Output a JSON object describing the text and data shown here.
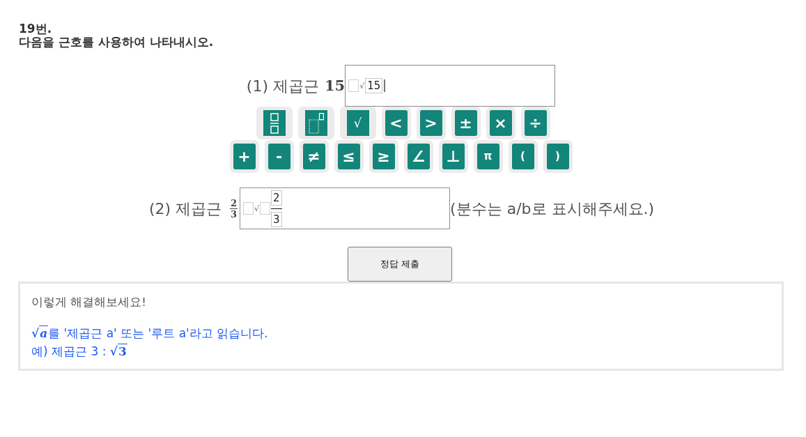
{
  "problem": {
    "number": "19번.",
    "instruction": "다음을 근호를 사용하여 나타내시오."
  },
  "question_1": {
    "label": "(1) 제곱근",
    "expression": {
      "kind": "number",
      "text": "15"
    },
    "answer": {
      "focused": true,
      "parts": [
        {
          "kind": "slot"
        },
        {
          "kind": "radical",
          "text": "√"
        },
        {
          "kind": "box",
          "text": "15"
        }
      ]
    }
  },
  "keypad": {
    "rows": [
      [
        {
          "kind": "fraction"
        },
        {
          "kind": "power"
        },
        {
          "kind": "radical",
          "label": "√"
        },
        {
          "kind": "symbol",
          "label": "<"
        },
        {
          "kind": "symbol",
          "label": ">"
        },
        {
          "kind": "symbol",
          "label": "±"
        },
        {
          "kind": "symbol",
          "label": "×"
        },
        {
          "kind": "symbol",
          "label": "÷"
        }
      ],
      [
        {
          "kind": "symbol",
          "label": "+"
        },
        {
          "kind": "symbol",
          "label": "-"
        },
        {
          "kind": "symbol",
          "label": "≠"
        },
        {
          "kind": "symbol",
          "label": "≤"
        },
        {
          "kind": "symbol",
          "label": "≥"
        },
        {
          "kind": "symbol",
          "label": "∠"
        },
        {
          "kind": "symbol",
          "label": "⊥"
        },
        {
          "kind": "letter",
          "label": "π"
        },
        {
          "kind": "letter",
          "label": "("
        },
        {
          "kind": "letter",
          "label": ")"
        }
      ]
    ]
  },
  "question_2": {
    "label": "(2) 제곱근",
    "expression": {
      "kind": "fraction",
      "numerator": "2",
      "denominator": "3"
    },
    "answer": {
      "focused": false,
      "parts": [
        {
          "kind": "slot"
        },
        {
          "kind": "radical",
          "text": "√"
        },
        {
          "kind": "slot"
        },
        {
          "kind": "fraction",
          "numerator": "2",
          "denominator": "3"
        }
      ]
    },
    "note": "(분수는 a/b로 표시해주세요.)"
  },
  "submit_button": {
    "label": "정답 제출"
  },
  "hint": {
    "title": "이렇게 해결해보세요!",
    "lines": [
      {
        "parts": [
          {
            "kind": "sqrt",
            "radical": "√",
            "radicand": "a"
          },
          {
            "kind": "text",
            "text": "를 '제곱근 a' 또는 '루트 a'라고 읽습니다."
          }
        ]
      },
      {
        "parts": [
          {
            "kind": "text",
            "text": "예) 제곱근 3 : "
          },
          {
            "kind": "sqrt",
            "radical": "√",
            "radicand": "3"
          }
        ]
      }
    ]
  }
}
